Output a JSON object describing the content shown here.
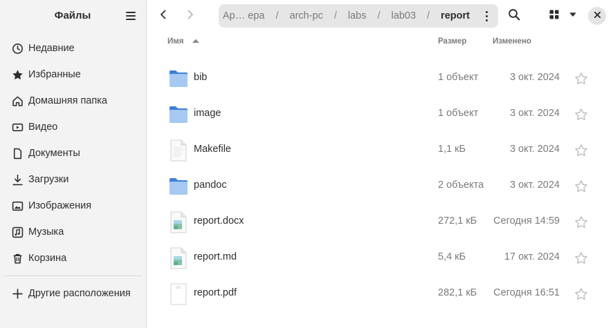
{
  "sidebar": {
    "title": "Файлы",
    "items": [
      {
        "label": "Недавние",
        "icon": "clock-icon"
      },
      {
        "label": "Избранные",
        "icon": "star-icon"
      },
      {
        "label": "Домашняя папка",
        "icon": "home-icon"
      },
      {
        "label": "Видео",
        "icon": "video-icon"
      },
      {
        "label": "Документы",
        "icon": "document-icon"
      },
      {
        "label": "Загрузки",
        "icon": "download-icon"
      },
      {
        "label": "Изображения",
        "icon": "image-icon"
      },
      {
        "label": "Музыка",
        "icon": "music-icon"
      },
      {
        "label": "Корзина",
        "icon": "trash-icon"
      }
    ],
    "other": {
      "label": "Другие расположения",
      "icon": "plus-icon"
    }
  },
  "header": {
    "breadcrumbs": [
      "Ар… ера",
      "arch-pc",
      "labs",
      "lab03",
      "report"
    ],
    "separator": "/"
  },
  "columns": {
    "name": "Имя",
    "size": "Размер",
    "modified": "Изменено"
  },
  "files": [
    {
      "name": "bib",
      "size": "1 объект",
      "modified": "3 окт. 2024",
      "type": "folder"
    },
    {
      "name": "image",
      "size": "1 объект",
      "modified": "3 окт. 2024",
      "type": "folder"
    },
    {
      "name": "Makefile",
      "size": "1,1 кБ",
      "modified": "3 окт. 2024",
      "type": "text"
    },
    {
      "name": "pandoc",
      "size": "2 объекта",
      "modified": "3 окт. 2024",
      "type": "folder"
    },
    {
      "name": "report.docx",
      "size": "272,1 кБ",
      "modified": "Сегодня 14:59",
      "type": "image-doc"
    },
    {
      "name": "report.md",
      "size": "5,4 кБ",
      "modified": "17 окт. 2024",
      "type": "image-doc"
    },
    {
      "name": "report.pdf",
      "size": "282,1 кБ",
      "modified": "Сегодня 16:51",
      "type": "pdf"
    }
  ],
  "colors": {
    "folder": "#62a0ea",
    "folder_front": "#a6c9f2",
    "sidebar_bg": "#f3f3f3",
    "pathbar_bg": "#e6e6e6"
  }
}
